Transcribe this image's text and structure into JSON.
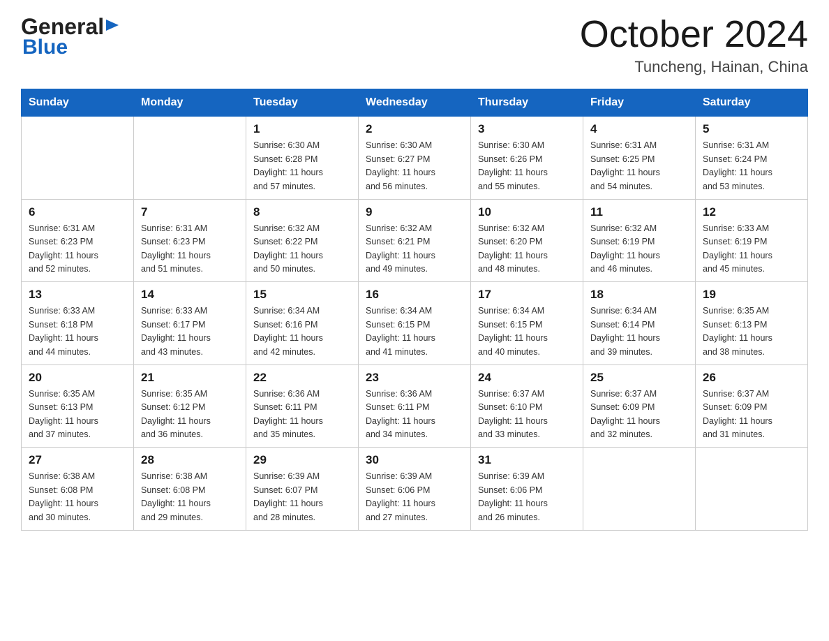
{
  "header": {
    "logo_general": "General",
    "logo_blue": "Blue",
    "month_title": "October 2024",
    "location": "Tuncheng, Hainan, China"
  },
  "calendar": {
    "days_of_week": [
      "Sunday",
      "Monday",
      "Tuesday",
      "Wednesday",
      "Thursday",
      "Friday",
      "Saturday"
    ],
    "weeks": [
      [
        {
          "day": "",
          "info": ""
        },
        {
          "day": "",
          "info": ""
        },
        {
          "day": "1",
          "info": "Sunrise: 6:30 AM\nSunset: 6:28 PM\nDaylight: 11 hours\nand 57 minutes."
        },
        {
          "day": "2",
          "info": "Sunrise: 6:30 AM\nSunset: 6:27 PM\nDaylight: 11 hours\nand 56 minutes."
        },
        {
          "day": "3",
          "info": "Sunrise: 6:30 AM\nSunset: 6:26 PM\nDaylight: 11 hours\nand 55 minutes."
        },
        {
          "day": "4",
          "info": "Sunrise: 6:31 AM\nSunset: 6:25 PM\nDaylight: 11 hours\nand 54 minutes."
        },
        {
          "day": "5",
          "info": "Sunrise: 6:31 AM\nSunset: 6:24 PM\nDaylight: 11 hours\nand 53 minutes."
        }
      ],
      [
        {
          "day": "6",
          "info": "Sunrise: 6:31 AM\nSunset: 6:23 PM\nDaylight: 11 hours\nand 52 minutes."
        },
        {
          "day": "7",
          "info": "Sunrise: 6:31 AM\nSunset: 6:23 PM\nDaylight: 11 hours\nand 51 minutes."
        },
        {
          "day": "8",
          "info": "Sunrise: 6:32 AM\nSunset: 6:22 PM\nDaylight: 11 hours\nand 50 minutes."
        },
        {
          "day": "9",
          "info": "Sunrise: 6:32 AM\nSunset: 6:21 PM\nDaylight: 11 hours\nand 49 minutes."
        },
        {
          "day": "10",
          "info": "Sunrise: 6:32 AM\nSunset: 6:20 PM\nDaylight: 11 hours\nand 48 minutes."
        },
        {
          "day": "11",
          "info": "Sunrise: 6:32 AM\nSunset: 6:19 PM\nDaylight: 11 hours\nand 46 minutes."
        },
        {
          "day": "12",
          "info": "Sunrise: 6:33 AM\nSunset: 6:19 PM\nDaylight: 11 hours\nand 45 minutes."
        }
      ],
      [
        {
          "day": "13",
          "info": "Sunrise: 6:33 AM\nSunset: 6:18 PM\nDaylight: 11 hours\nand 44 minutes."
        },
        {
          "day": "14",
          "info": "Sunrise: 6:33 AM\nSunset: 6:17 PM\nDaylight: 11 hours\nand 43 minutes."
        },
        {
          "day": "15",
          "info": "Sunrise: 6:34 AM\nSunset: 6:16 PM\nDaylight: 11 hours\nand 42 minutes."
        },
        {
          "day": "16",
          "info": "Sunrise: 6:34 AM\nSunset: 6:15 PM\nDaylight: 11 hours\nand 41 minutes."
        },
        {
          "day": "17",
          "info": "Sunrise: 6:34 AM\nSunset: 6:15 PM\nDaylight: 11 hours\nand 40 minutes."
        },
        {
          "day": "18",
          "info": "Sunrise: 6:34 AM\nSunset: 6:14 PM\nDaylight: 11 hours\nand 39 minutes."
        },
        {
          "day": "19",
          "info": "Sunrise: 6:35 AM\nSunset: 6:13 PM\nDaylight: 11 hours\nand 38 minutes."
        }
      ],
      [
        {
          "day": "20",
          "info": "Sunrise: 6:35 AM\nSunset: 6:13 PM\nDaylight: 11 hours\nand 37 minutes."
        },
        {
          "day": "21",
          "info": "Sunrise: 6:35 AM\nSunset: 6:12 PM\nDaylight: 11 hours\nand 36 minutes."
        },
        {
          "day": "22",
          "info": "Sunrise: 6:36 AM\nSunset: 6:11 PM\nDaylight: 11 hours\nand 35 minutes."
        },
        {
          "day": "23",
          "info": "Sunrise: 6:36 AM\nSunset: 6:11 PM\nDaylight: 11 hours\nand 34 minutes."
        },
        {
          "day": "24",
          "info": "Sunrise: 6:37 AM\nSunset: 6:10 PM\nDaylight: 11 hours\nand 33 minutes."
        },
        {
          "day": "25",
          "info": "Sunrise: 6:37 AM\nSunset: 6:09 PM\nDaylight: 11 hours\nand 32 minutes."
        },
        {
          "day": "26",
          "info": "Sunrise: 6:37 AM\nSunset: 6:09 PM\nDaylight: 11 hours\nand 31 minutes."
        }
      ],
      [
        {
          "day": "27",
          "info": "Sunrise: 6:38 AM\nSunset: 6:08 PM\nDaylight: 11 hours\nand 30 minutes."
        },
        {
          "day": "28",
          "info": "Sunrise: 6:38 AM\nSunset: 6:08 PM\nDaylight: 11 hours\nand 29 minutes."
        },
        {
          "day": "29",
          "info": "Sunrise: 6:39 AM\nSunset: 6:07 PM\nDaylight: 11 hours\nand 28 minutes."
        },
        {
          "day": "30",
          "info": "Sunrise: 6:39 AM\nSunset: 6:06 PM\nDaylight: 11 hours\nand 27 minutes."
        },
        {
          "day": "31",
          "info": "Sunrise: 6:39 AM\nSunset: 6:06 PM\nDaylight: 11 hours\nand 26 minutes."
        },
        {
          "day": "",
          "info": ""
        },
        {
          "day": "",
          "info": ""
        }
      ]
    ]
  }
}
